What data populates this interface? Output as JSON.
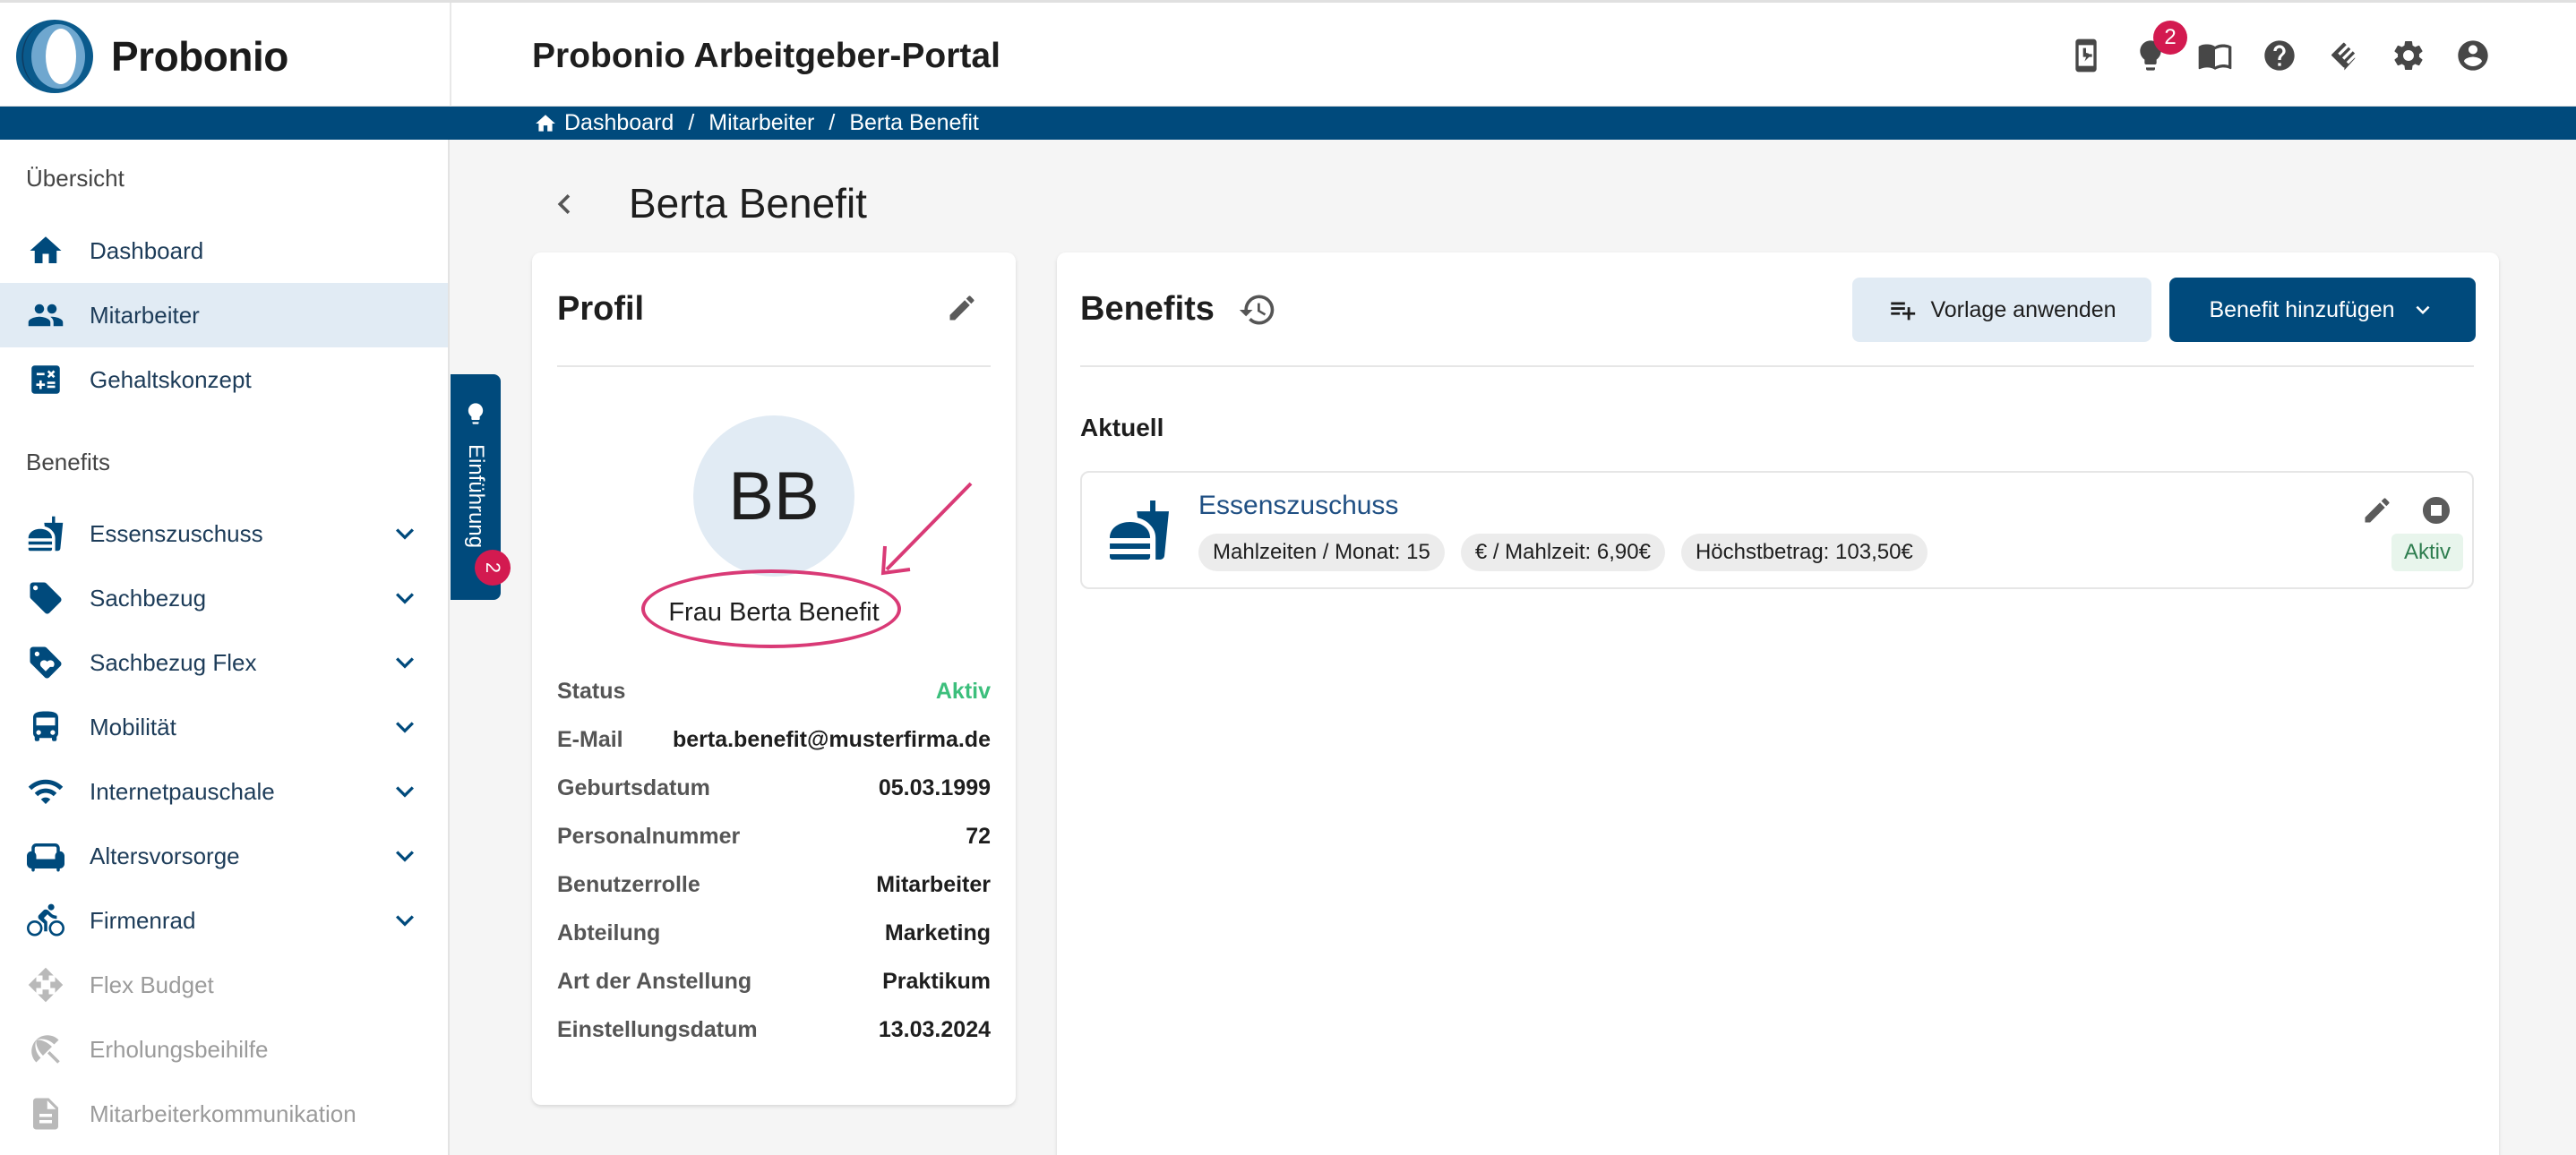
{
  "app": {
    "brand": "Probonio",
    "portal_title": "Probonio Arbeitgeber-Portal",
    "notification_count": "2",
    "header_icons": [
      "mobile-app-icon",
      "lightbulb-icon",
      "book-icon",
      "help-icon",
      "handshake-icon",
      "gear-icon",
      "account-icon"
    ]
  },
  "breadcrumb": [
    "Dashboard",
    "Mitarbeiter",
    "Berta Benefit"
  ],
  "sidebar": {
    "overview_title": "Übersicht",
    "overview_items": [
      {
        "label": "Dashboard",
        "icon": "home-icon"
      },
      {
        "label": "Mitarbeiter",
        "icon": "people-icon",
        "active": true
      },
      {
        "label": "Gehaltskonzept",
        "icon": "calculator-icon"
      }
    ],
    "benefits_title": "Benefits",
    "benefit_items": [
      {
        "label": "Essenszuschuss",
        "icon": "food-icon"
      },
      {
        "label": "Sachbezug",
        "icon": "tag-icon"
      },
      {
        "label": "Sachbezug Flex",
        "icon": "tag-heart-icon"
      },
      {
        "label": "Mobilität",
        "icon": "bus-icon"
      },
      {
        "label": "Internetpauschale",
        "icon": "wifi-icon"
      },
      {
        "label": "Altersvorsorge",
        "icon": "armchair-icon"
      },
      {
        "label": "Firmenrad",
        "icon": "bike-icon"
      },
      {
        "label": "Flex Budget",
        "icon": "arrows-icon",
        "disabled": true
      },
      {
        "label": "Erholungsbeihilfe",
        "icon": "palm-icon",
        "disabled": true
      },
      {
        "label": "Mitarbeiterkommunikation",
        "icon": "document-icon",
        "disabled": true
      }
    ]
  },
  "intro": {
    "label": "Einführung",
    "badge": "2"
  },
  "page": {
    "title": "Berta Benefit"
  },
  "profile": {
    "heading": "Profil",
    "initials": "BB",
    "full_name": "Frau Berta Benefit",
    "fields": [
      {
        "key": "Status",
        "value": "Aktiv",
        "color": "#3cbf7c"
      },
      {
        "key": "E-Mail",
        "value": "berta.benefit@musterfirma.de"
      },
      {
        "key": "Geburtsdatum",
        "value": "05.03.1999"
      },
      {
        "key": "Personalnummer",
        "value": "72"
      },
      {
        "key": "Benutzerrolle",
        "value": "Mitarbeiter"
      },
      {
        "key": "Abteilung",
        "value": "Marketing"
      },
      {
        "key": "Art der Anstellung",
        "value": "Praktikum"
      },
      {
        "key": "Einstellungsdatum",
        "value": "13.03.2024"
      }
    ]
  },
  "benefits": {
    "heading": "Benefits",
    "apply_template_label": "Vorlage anwenden",
    "add_benefit_label": "Benefit hinzufügen",
    "current_label": "Aktuell",
    "items": [
      {
        "name": "Essenszuschuss",
        "chips": [
          "Mahlzeiten / Monat: 15",
          "€ / Mahlzeit: 6,90€",
          "Höchstbetrag: 103,50€"
        ],
        "status": "Aktiv"
      }
    ]
  },
  "colors": {
    "brand": "#004a7c",
    "accent_badge": "#d31a50",
    "annotation": "#d93a76",
    "active_status": "#3cbf7c"
  }
}
